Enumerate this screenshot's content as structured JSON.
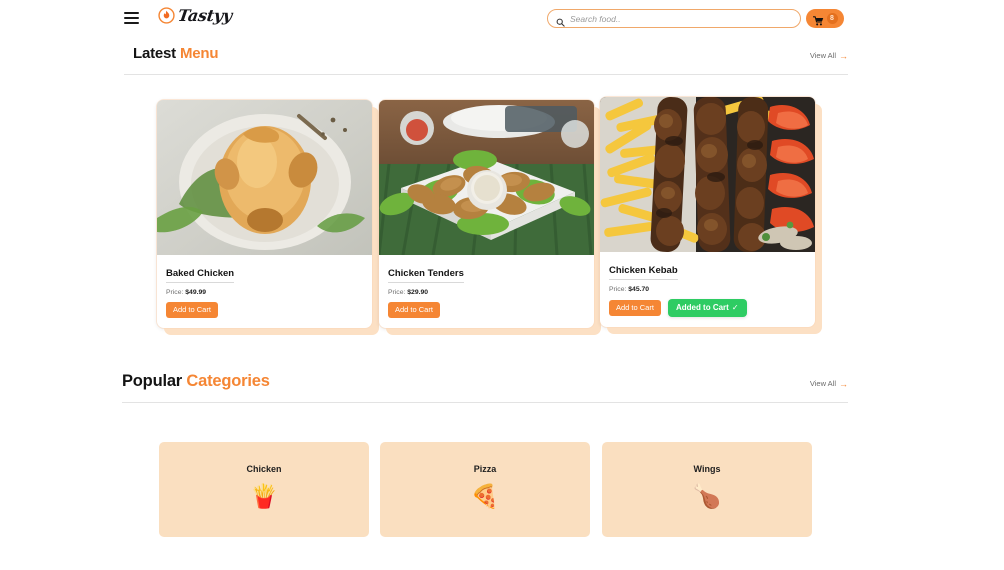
{
  "header": {
    "menu_icon": "hamburger-icon",
    "logo_text": "Tastyy",
    "logo_icon": "flame-icon",
    "search": {
      "icon": "search-icon",
      "placeholder": "Search food..",
      "value": ""
    },
    "cart": {
      "icon": "shopping-cart-icon",
      "badge_count": "8"
    }
  },
  "sections": {
    "latest": {
      "title_primary": "Latest",
      "title_accent": "Menu",
      "view_all_label": "View All",
      "view_all_arrow": "→"
    },
    "popular": {
      "title_primary": "Popular",
      "title_accent": "Categories",
      "view_all_label": "View All",
      "view_all_arrow": "→"
    }
  },
  "food_items": [
    {
      "name": "Baked Chicken",
      "price_label": "Price:",
      "price": "$49.99",
      "add_label": "Add to Cart",
      "image_alt": "baked-whole-chicken-photo"
    },
    {
      "name": "Chicken Tenders",
      "price_label": "Price:",
      "price": "$29.90",
      "add_label": "Add to Cart",
      "image_alt": "chicken-tenders-platter-photo"
    },
    {
      "name": "Chicken Kebab",
      "price_label": "Price:",
      "price": "$45.70",
      "add_label": "Add to Cart",
      "image_alt": "chicken-kebab-with-fries-photo",
      "added_toast": "Added to Cart",
      "added_tick": "✓"
    }
  ],
  "categories": [
    {
      "label": "Chicken",
      "emoji": "🍟",
      "icon_name": "fries-drink-icon"
    },
    {
      "label": "Pizza",
      "emoji": "🍕",
      "icon_name": "pizza-slice-icon"
    },
    {
      "label": "Wings",
      "emoji": "🍗",
      "icon_name": "chicken-wings-icon"
    }
  ],
  "colors": {
    "accent": "#f58634",
    "accent_dark": "#e4701e",
    "success": "#2ecc63",
    "category_bg": "#fadfc0",
    "card_shadow": "#fce0c4",
    "text": "#141414"
  }
}
